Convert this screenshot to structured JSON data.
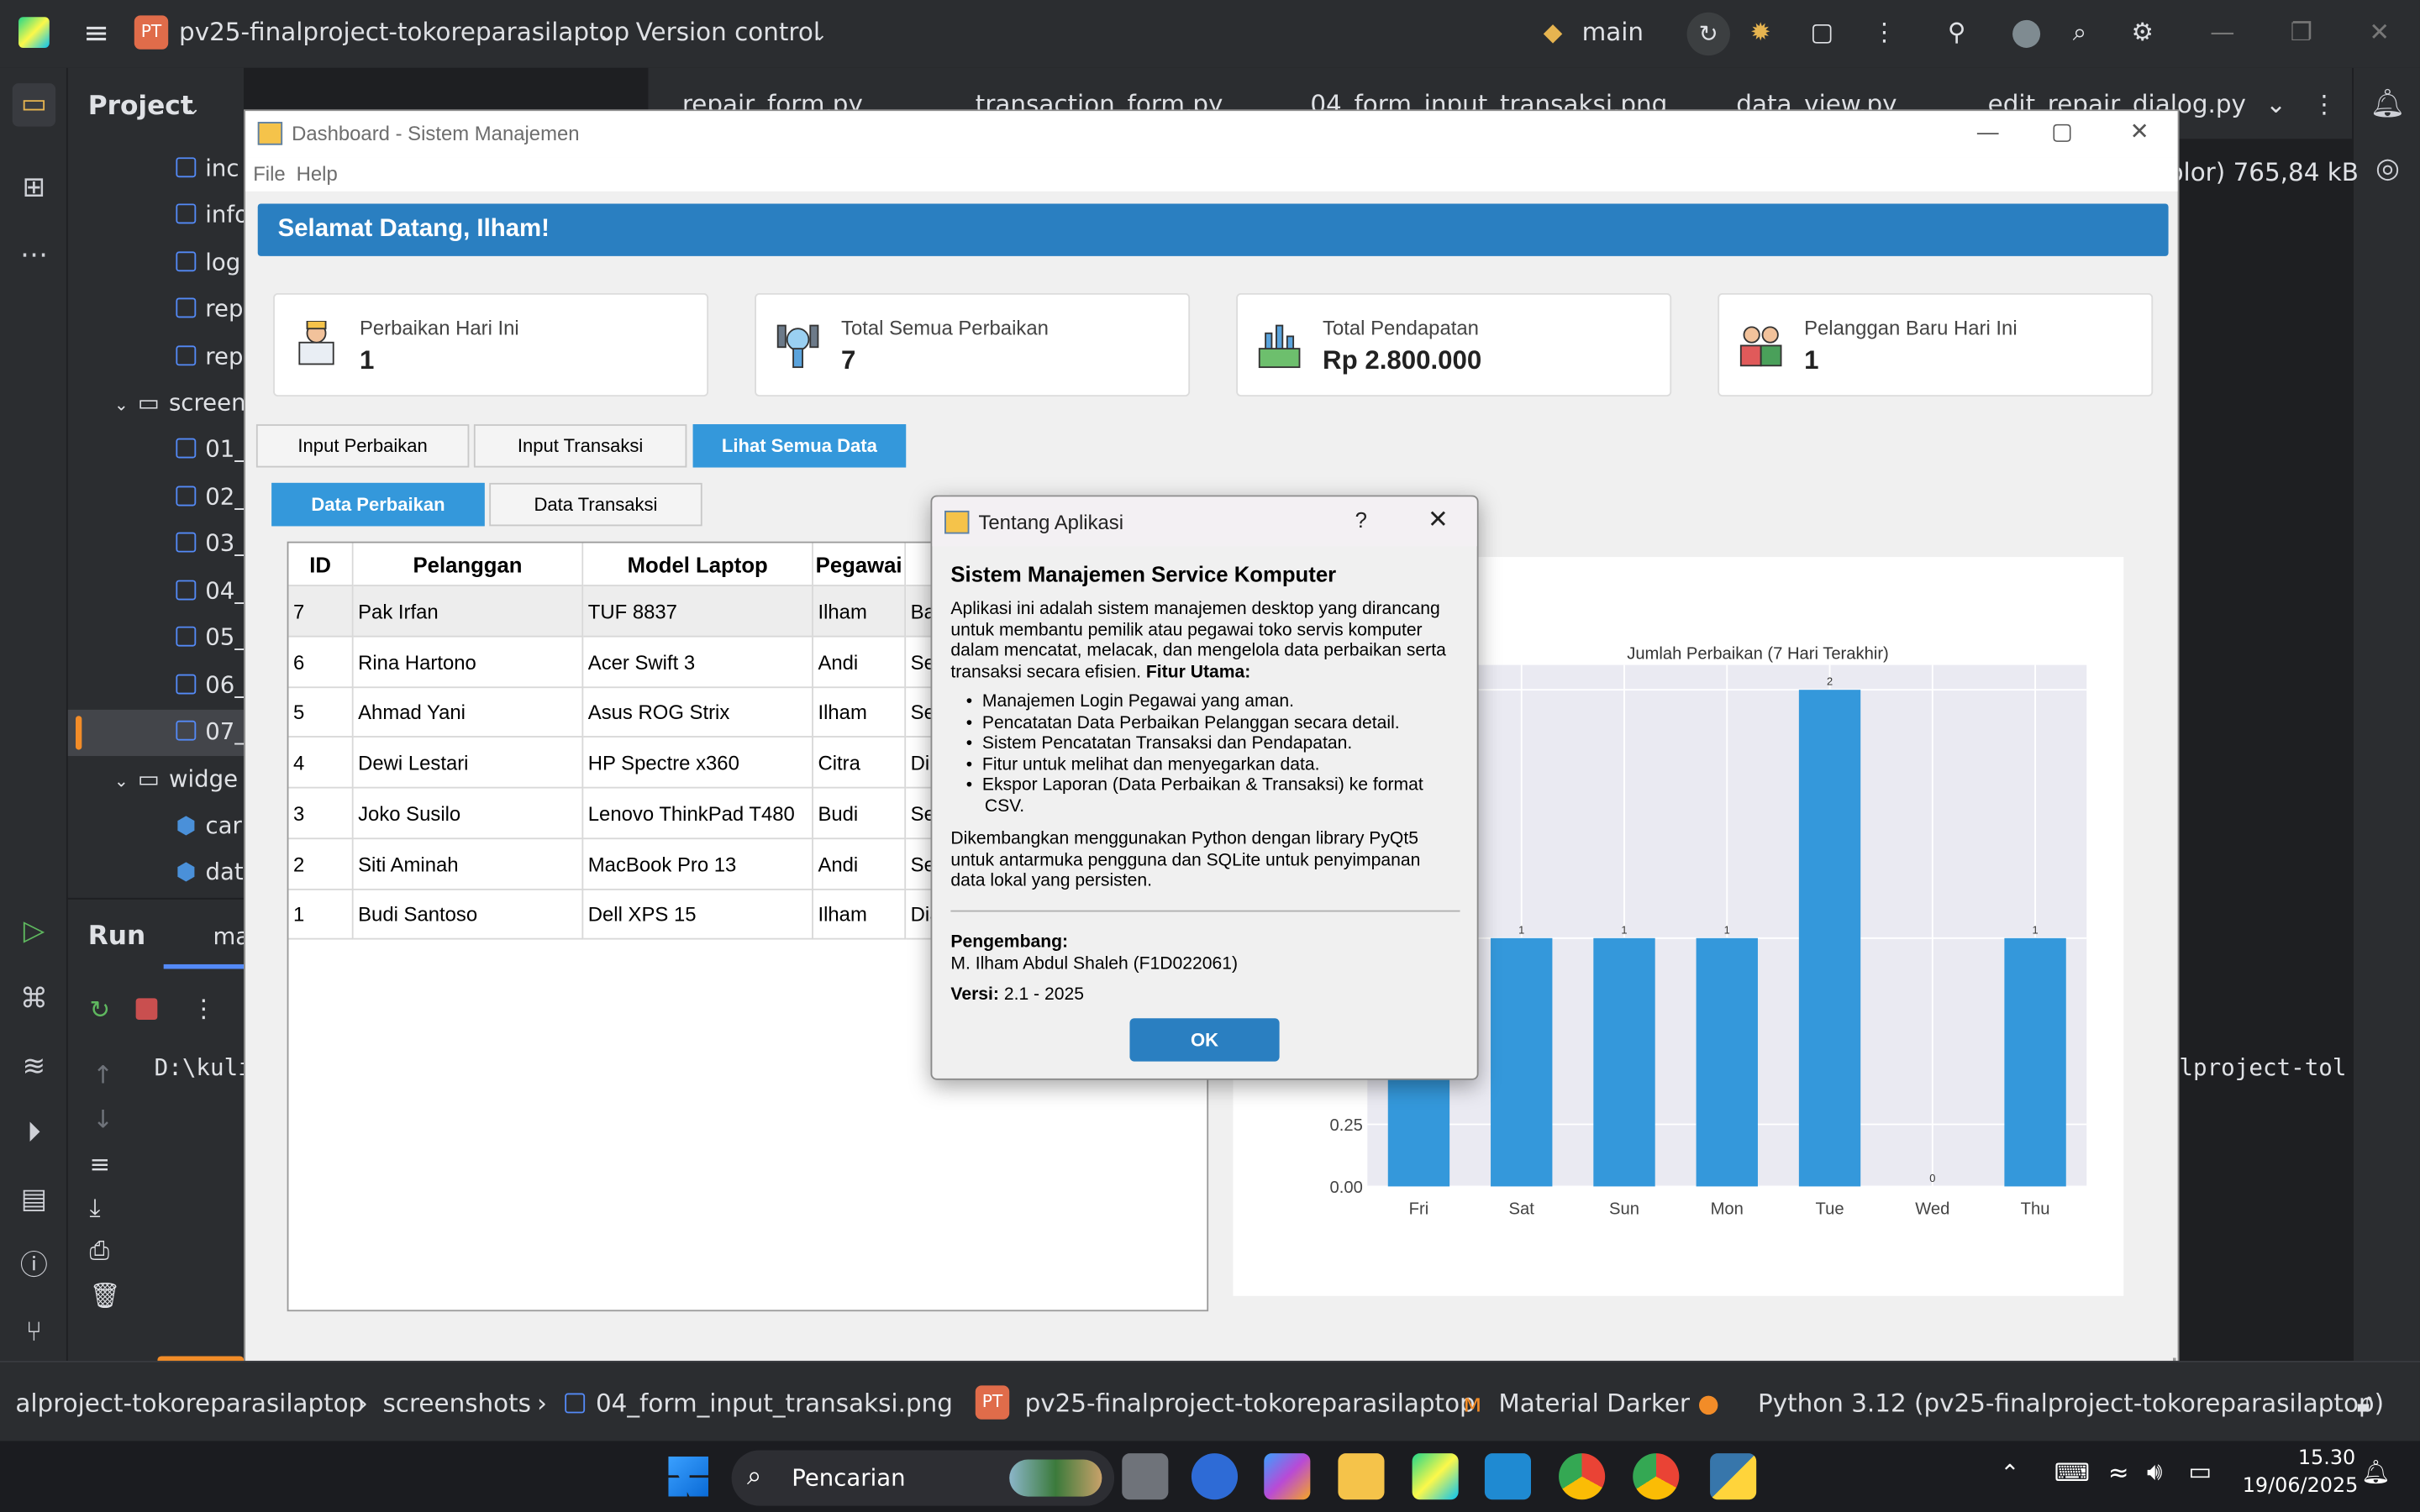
{
  "ide": {
    "project_badge": "PT",
    "project_name": "pv25-finalproject-tokoreparasilaptop",
    "version_control": "Version control",
    "branch": "main",
    "project_label": "Project",
    "tree": [
      "inc",
      "info",
      "log",
      "rep",
      "rep",
      "screen",
      "01_",
      "02_",
      "03_",
      "04_",
      "05_",
      "06_",
      "07_",
      "widge",
      "car",
      "dat"
    ],
    "tabs": [
      "repair_form.py",
      "transaction_form.py",
      "04_form_input_transaksi.png",
      "data_view.py",
      "edit_repair_dialog.py"
    ],
    "image_info": "olor) 765,84 kB",
    "run_label": "Run",
    "run_tab": "ma",
    "console_left": "D:\\kuli",
    "console_right": "lproject-tol",
    "status": {
      "path1": "alproject-tokoreparasilaptop",
      "path2": "screenshots",
      "path3": "04_form_input_transaksi.png",
      "badge": "PT",
      "project": "pv25-finalproject-tokoreparasilaptop",
      "theme": "Material Darker",
      "interpreter": "Python 3.12 (pv25-finalproject-tokoreparasilaptop)"
    }
  },
  "taskbar": {
    "search": "Pencarian",
    "time": "15.30",
    "date": "19/06/2025"
  },
  "window": {
    "title": "Dashboard - Sistem Manajemen",
    "menu": [
      "File",
      "Help"
    ],
    "welcome": "Selamat Datang, Ilham!",
    "cards": [
      {
        "label": "Perbaikan Hari Ini",
        "value": "1",
        "icon": "technician-icon"
      },
      {
        "label": "Total Semua Perbaikan",
        "value": "7",
        "icon": "tools-icon"
      },
      {
        "label": "Total Pendapatan",
        "value": "Rp 2.800.000",
        "icon": "revenue-icon"
      },
      {
        "label": "Pelanggan Baru Hari Ini",
        "value": "1",
        "icon": "customers-icon"
      }
    ],
    "main_tabs": [
      "Input Perbaikan",
      "Input Transaksi",
      "Lihat Semua Data"
    ],
    "sub_tabs": [
      "Data Perbaikan",
      "Data Transaksi"
    ],
    "table": {
      "columns": [
        "ID",
        "Pelanggan",
        "Model Laptop",
        "Pegawai",
        ""
      ],
      "rows": [
        [
          "7",
          "Pak Irfan",
          "TUF 8837",
          "Ilham",
          "Ba"
        ],
        [
          "6",
          "Rina Hartono",
          "Acer Swift 3",
          "Andi",
          "Sel"
        ],
        [
          "5",
          "Ahmad Yani",
          "Asus ROG Strix",
          "Ilham",
          "Sel"
        ],
        [
          "4",
          "Dewi Lestari",
          "HP Spectre x360",
          "Citra",
          "Dik"
        ],
        [
          "3",
          "Joko Susilo",
          "Lenovo ThinkPad T480",
          "Budi",
          "Sel"
        ],
        [
          "2",
          "Siti Aminah",
          "MacBook Pro 13",
          "Andi",
          "Sel"
        ],
        [
          "1",
          "Budi Santoso",
          "Dell XPS 15",
          "Ilham",
          "Dia"
        ]
      ]
    }
  },
  "chart_data": {
    "type": "bar",
    "title": "Jumlah Perbaikan (7 Hari Terakhir)",
    "categories": [
      "Fri",
      "Sat",
      "Sun",
      "Mon",
      "Tue",
      "Wed",
      "Thu"
    ],
    "values": [
      1,
      1,
      1,
      1,
      2,
      0,
      1
    ],
    "data_labels": [
      "1",
      "1",
      "1",
      "1",
      "2",
      "0",
      "1"
    ],
    "visible_y_ticks": [
      "0.00",
      "0.25"
    ],
    "ylim": [
      0,
      2.1
    ],
    "bar_color": "#3498db",
    "grid": true
  },
  "dialog": {
    "title": "Tentang Aplikasi",
    "help": "?",
    "heading": "Sistem Manajemen Service Komputer",
    "intro": "Aplikasi ini adalah sistem manajemen desktop yang dirancang untuk membantu pemilik atau pegawai toko servis komputer dalam mencatat, melacak, dan mengelola data perbaikan serta transaksi secara efisien.",
    "features_label": "Fitur Utama:",
    "features": [
      "Manajemen Login Pegawai yang aman.",
      "Pencatatan Data Perbaikan Pelanggan secara detail.",
      "Sistem Pencatatan Transaksi dan Pendapatan.",
      "Fitur untuk melihat dan menyegarkan data.",
      "Ekspor Laporan (Data Perbaikan & Transaksi) ke format CSV."
    ],
    "tech": "Dikembangkan menggunakan Python dengan library PyQt5 untuk antarmuka pengguna dan SQLite untuk penyimpanan data lokal yang persisten.",
    "dev_label": "Pengembang:",
    "dev_name": "M. Ilham Abdul Shaleh (F1D022061)",
    "version_label": "Versi:",
    "version": "2.1 - 2025",
    "ok": "OK"
  }
}
